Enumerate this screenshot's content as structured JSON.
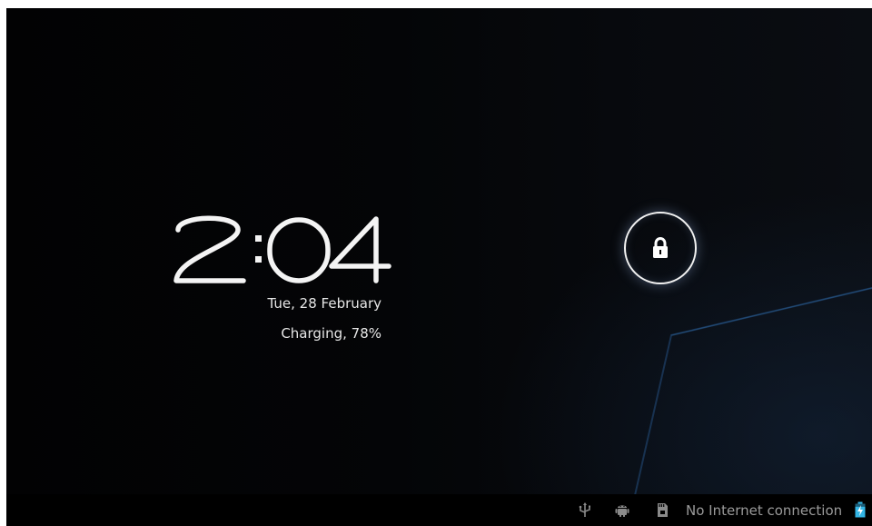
{
  "clock": {
    "hour": "2",
    "minutes": "04"
  },
  "date_text": "Tue, 28 February",
  "charging_text": "Charging, 78%",
  "lock": {
    "icon": "lock-icon"
  },
  "status_bar": {
    "network_text": "No Internet connection",
    "battery_level_percent": 78,
    "icons": [
      "usb-icon",
      "android-debug-icon",
      "sd-card-icon",
      "battery-charging-icon"
    ]
  },
  "colors": {
    "background": "#000000",
    "text": "#e6e6e6",
    "status_text": "#9a9a9a",
    "battery": "#33b5e5"
  }
}
